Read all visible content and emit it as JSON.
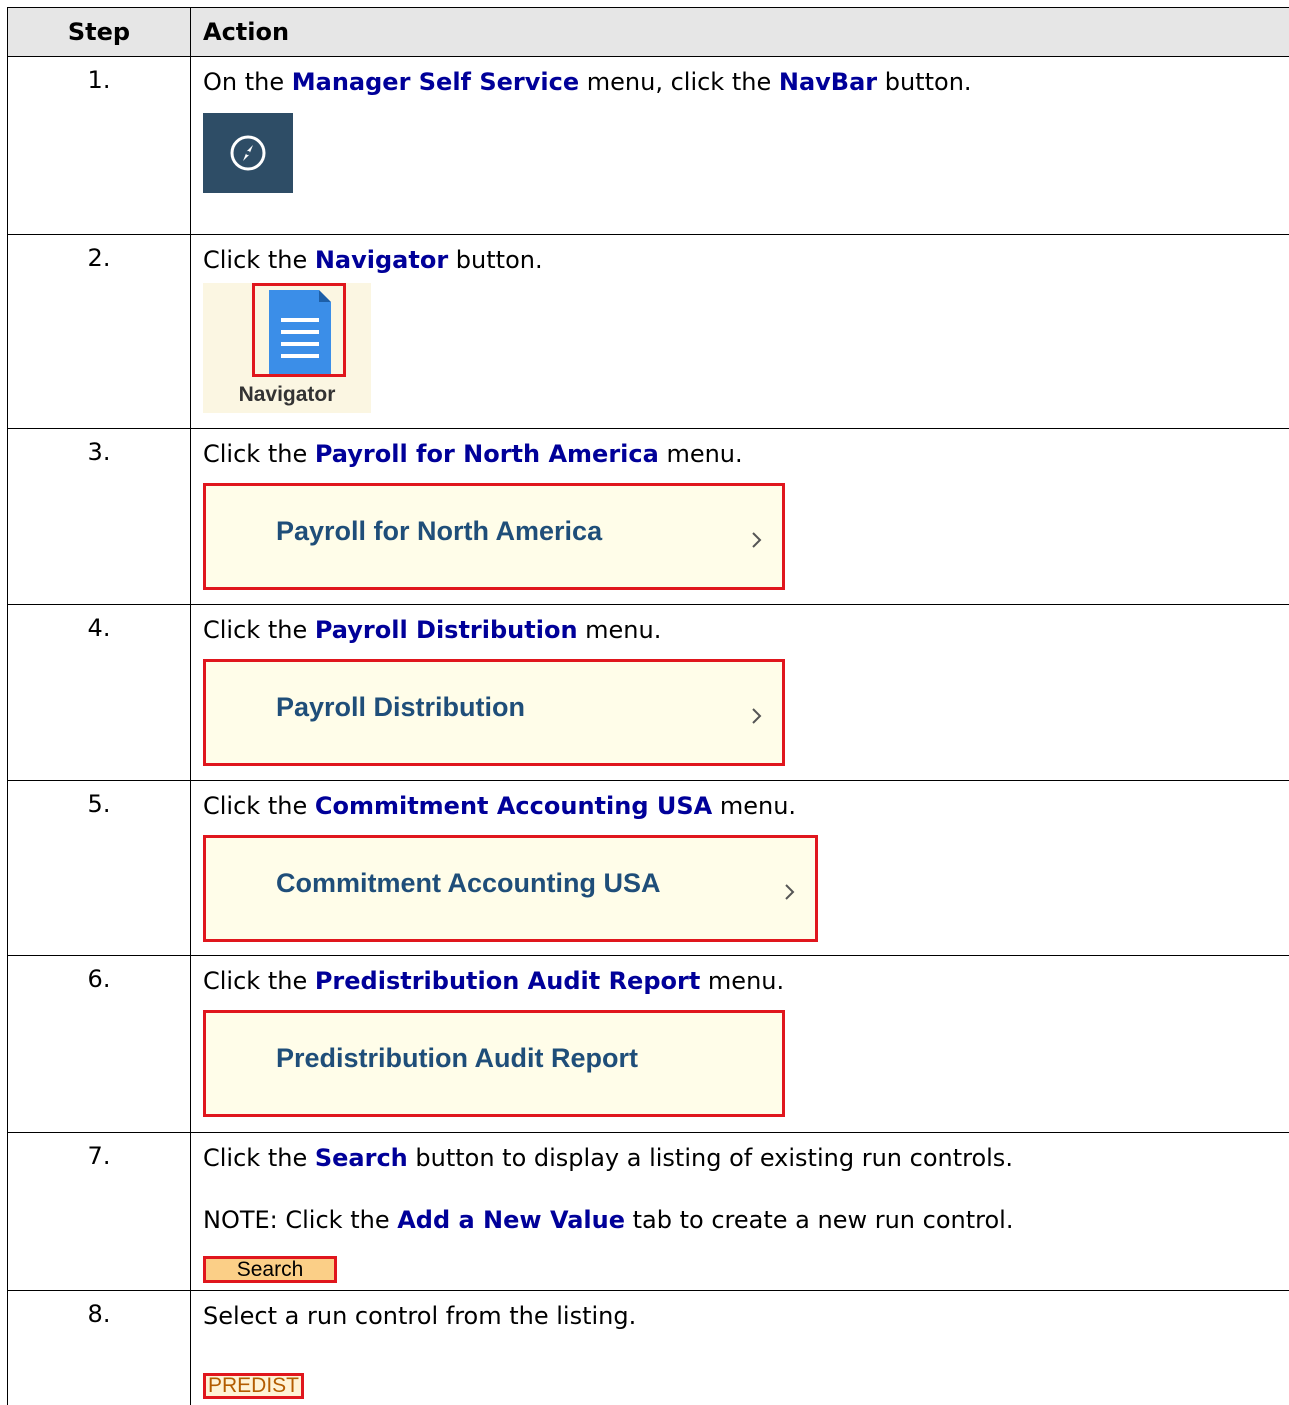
{
  "header": {
    "step": "Step",
    "action": "Action"
  },
  "steps": [
    {
      "number": "1.",
      "pre": "On the ",
      "b1": "Manager Self Service",
      "mid": " menu, click the ",
      "b2": "NavBar",
      "post": " button."
    },
    {
      "number": "2.",
      "pre": "Click the ",
      "b1": "Navigator",
      "post": " button.",
      "tile_label": "Navigator"
    },
    {
      "number": "3.",
      "pre": "Click the ",
      "b1": "Payroll for North America",
      "post": " menu.",
      "tile_label": "Payroll for North America"
    },
    {
      "number": "4.",
      "pre": "Click the ",
      "b1": "Payroll Distribution",
      "post": " menu.",
      "tile_label": "Payroll Distribution"
    },
    {
      "number": "5.",
      "pre": "Click the ",
      "b1": "Commitment Accounting USA",
      "post": " menu.",
      "tile_label": "Commitment Accounting USA"
    },
    {
      "number": "6.",
      "pre": "Click the ",
      "b1": "Predistribution Audit Report",
      "post": " menu.",
      "tile_label": "Predistribution Audit Report"
    },
    {
      "number": "7.",
      "pre": "Click the ",
      "b1": "Search",
      "post": " button to display a listing of existing run controls.",
      "note_pre": "NOTE: Click the ",
      "note_b": "Add a New Value",
      "note_post": " tab to create a new run control.",
      "button_label": "Search"
    },
    {
      "number": "8.",
      "text": "Select a run control from the listing.",
      "link_label": "PREDIST"
    }
  ]
}
